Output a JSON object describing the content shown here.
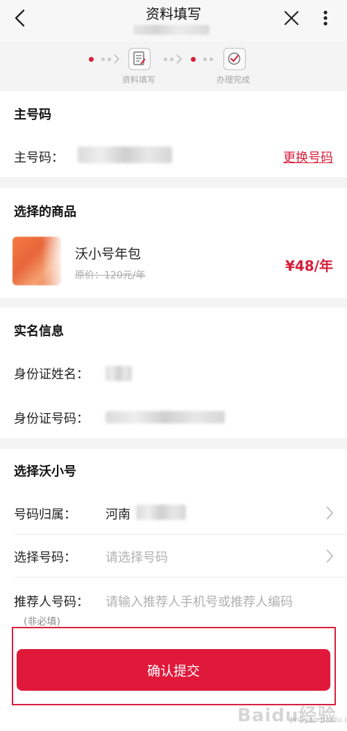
{
  "header": {
    "title": "资料填写",
    "back_icon": "chevron-left-icon",
    "close_icon": "close-icon",
    "more_icon": "more-vertical-icon"
  },
  "steps": {
    "items": [
      {
        "label": "资料填写",
        "icon": "edit-doc-icon"
      },
      {
        "label": "办理完成",
        "icon": "check-circle-icon"
      }
    ]
  },
  "main_number": {
    "section_title": "主号码",
    "label": "主号码：",
    "change_link": "更换号码"
  },
  "product": {
    "section_title": "选择的商品",
    "name": "沃小号年包",
    "original_price": "原价：120元/年",
    "price": "¥48/年"
  },
  "realname": {
    "section_title": "实名信息",
    "name_label": "身份证姓名：",
    "id_label": "身份证号码："
  },
  "select_number": {
    "section_title": "选择沃小号",
    "region_label": "号码归属：",
    "region_value": "河南",
    "number_label": "选择号码：",
    "number_placeholder": "请选择号码",
    "referrer_label": "推荐人号码：",
    "referrer_placeholder": "请输入推荐人手机号或推荐人编码",
    "referrer_note": "(非必填)"
  },
  "footer": {
    "confirm_label": "确认提交"
  },
  "watermark": {
    "text": "Baidu经验",
    "sub": "jingyan.baidu.com"
  },
  "colors": {
    "accent": "#d81e3a",
    "button": "#e0183a"
  }
}
